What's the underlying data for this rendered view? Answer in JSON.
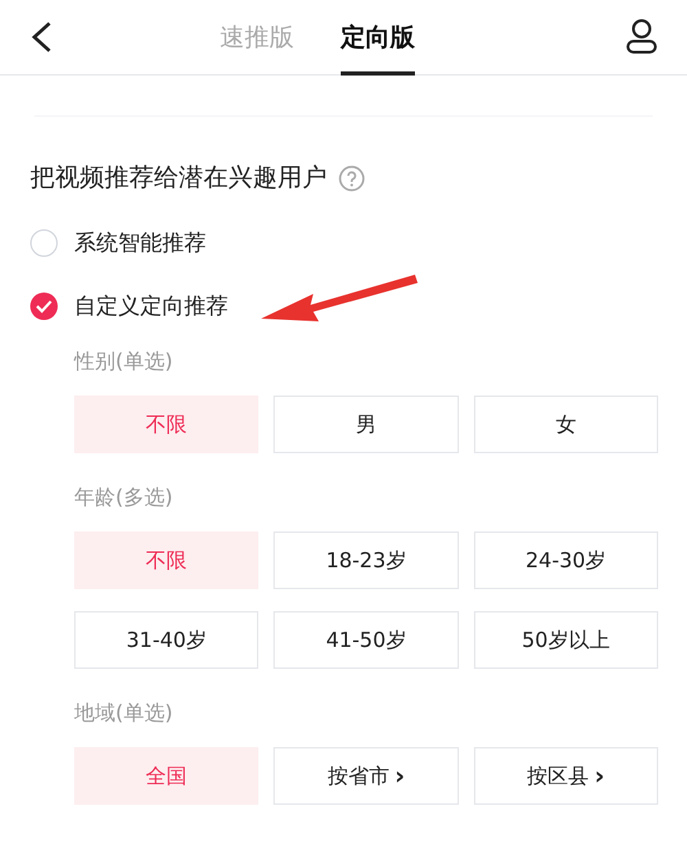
{
  "tabs": [
    {
      "label": "速推版",
      "selected": false
    },
    {
      "label": "定向版",
      "selected": true
    }
  ],
  "heading": "把视频推荐给潜在兴趣用户",
  "modes": [
    {
      "label": "系统智能推荐",
      "selected": false
    },
    {
      "label": "自定义定向推荐",
      "selected": true
    }
  ],
  "groups": [
    {
      "label": "性别(单选)",
      "options": [
        {
          "label": "不限",
          "selected": true
        },
        {
          "label": "男",
          "selected": false
        },
        {
          "label": "女",
          "selected": false
        }
      ]
    },
    {
      "label": "年龄(多选)",
      "options": [
        {
          "label": "不限",
          "selected": true
        },
        {
          "label": "18-23岁",
          "selected": false
        },
        {
          "label": "24-30岁",
          "selected": false
        },
        {
          "label": "31-40岁",
          "selected": false
        },
        {
          "label": "41-50岁",
          "selected": false
        },
        {
          "label": "50岁以上",
          "selected": false
        }
      ]
    },
    {
      "label": "地域(单选)",
      "options": [
        {
          "label": "全国",
          "selected": true
        },
        {
          "label": "按省市",
          "suffix": "›",
          "selected": false
        },
        {
          "label": "按区县",
          "suffix": "›",
          "selected": false
        }
      ]
    }
  ]
}
